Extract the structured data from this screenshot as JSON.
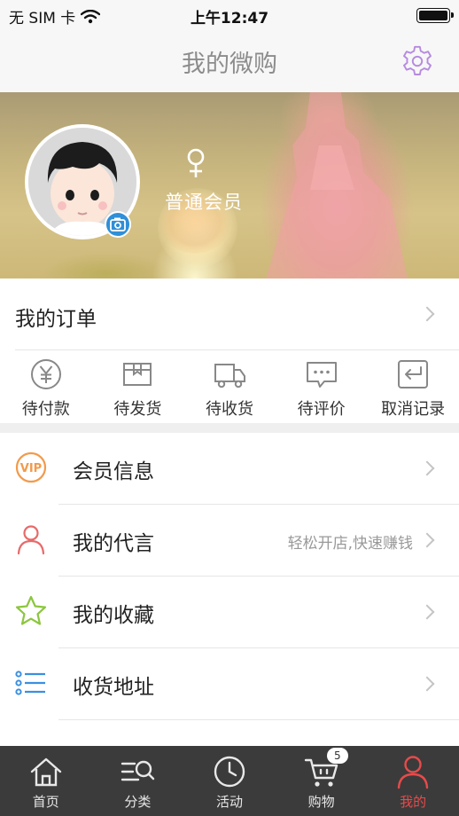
{
  "status_bar": {
    "carrier": "无 SIM 卡",
    "time": "上午12:47"
  },
  "nav": {
    "title": "我的微购",
    "settings_icon": "gear-icon",
    "accent": "#b68ae0"
  },
  "profile": {
    "member_level": "普通会员",
    "gender_icon": "female-icon",
    "camera_icon": "camera-icon"
  },
  "orders": {
    "title": "我的订单",
    "items": [
      {
        "label": "待付款",
        "icon": "yen-circle-icon"
      },
      {
        "label": "待发货",
        "icon": "package-box-icon"
      },
      {
        "label": "待收货",
        "icon": "truck-icon"
      },
      {
        "label": "待评价",
        "icon": "comment-bubble-icon"
      },
      {
        "label": "取消记录",
        "icon": "return-arrow-icon"
      }
    ]
  },
  "menu": [
    {
      "label": "会员信息",
      "icon": "vip-icon",
      "sub": ""
    },
    {
      "label": "我的代言",
      "icon": "person-icon",
      "sub": "轻松开店,快速赚钱"
    },
    {
      "label": "我的收藏",
      "icon": "star-icon",
      "sub": ""
    },
    {
      "label": "收货地址",
      "icon": "list-icon",
      "sub": ""
    }
  ],
  "tabs": [
    {
      "label": "首页",
      "icon": "home-icon"
    },
    {
      "label": "分类",
      "icon": "category-search-icon"
    },
    {
      "label": "活动",
      "icon": "clock-icon"
    },
    {
      "label": "购物",
      "icon": "cart-icon",
      "badge": "5"
    },
    {
      "label": "我的",
      "icon": "user-icon",
      "active": true
    }
  ],
  "colors": {
    "tab_active": "#e84a4a",
    "tab_bg": "#3b3b3b",
    "camera_badge": "#2f8fd8"
  }
}
